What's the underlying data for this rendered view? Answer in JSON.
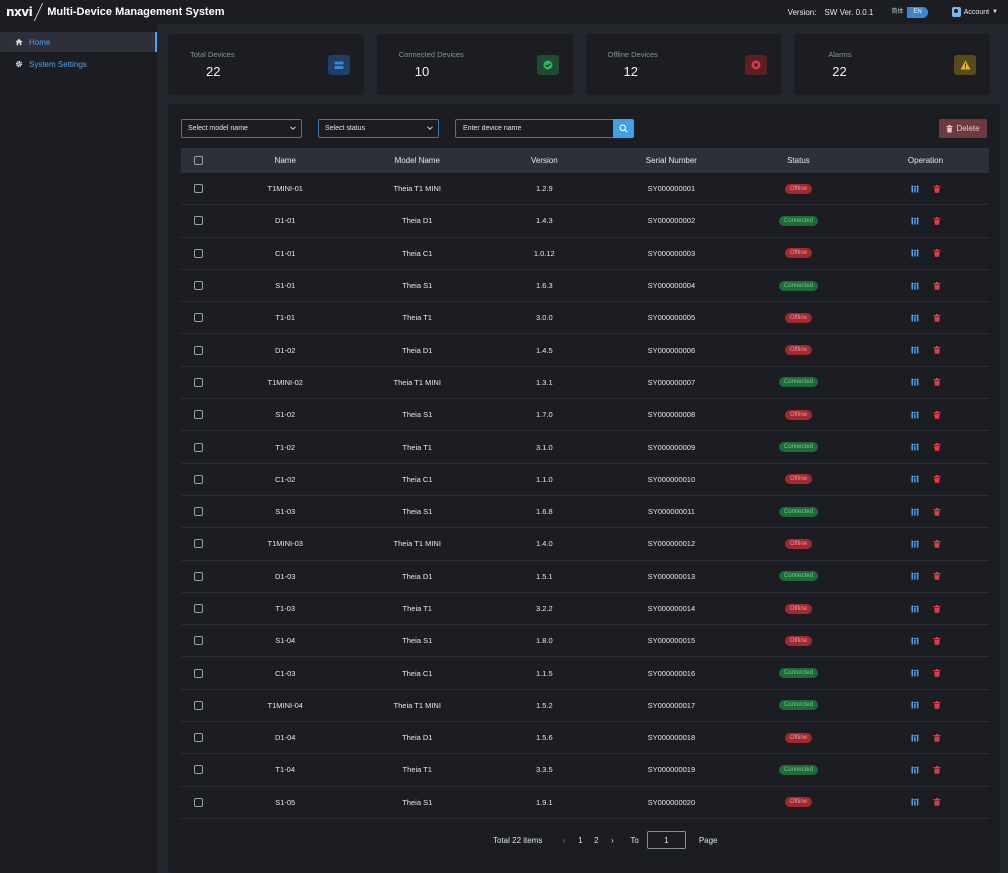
{
  "header": {
    "logo": "nxvi",
    "title": "Multi-Device Management System",
    "version_label": "Version:",
    "version_value": "SW Ver. 0.0.1",
    "lang_inactive": "简体",
    "lang_active": "EN",
    "account_label": "Account"
  },
  "sidebar": {
    "items": [
      {
        "label": "Home",
        "icon": "home-icon",
        "active": true
      },
      {
        "label": "System Settings",
        "icon": "gear-icon",
        "active": false
      }
    ]
  },
  "stats": [
    {
      "label": "Total Devices",
      "value": "22",
      "icon": "stack-icon",
      "color": "#3a86d8"
    },
    {
      "label": "Connected Devices",
      "value": "10",
      "icon": "check-circle-icon",
      "color": "#2fb760"
    },
    {
      "label": "Offline Devices",
      "value": "12",
      "icon": "x-circle-icon",
      "color": "#e03b42"
    },
    {
      "label": "Alarms",
      "value": "22",
      "icon": "warning-icon",
      "color": "#e0b52c"
    }
  ],
  "filters": {
    "model_placeholder": "Select model name",
    "status_placeholder": "Select status",
    "search_placeholder": "Enter device name",
    "delete_label": "Delete"
  },
  "table": {
    "columns": [
      "Name",
      "Model Name",
      "Version",
      "Serial Number",
      "Status",
      "Operation"
    ],
    "rows": [
      {
        "name": "T1MINI-01",
        "model": "Theia T1 MINI",
        "version": "1.2.9",
        "serial": "SY000000001",
        "status": "Offline"
      },
      {
        "name": "D1-01",
        "model": "Theia D1",
        "version": "1.4.3",
        "serial": "SY000000002",
        "status": "Connected"
      },
      {
        "name": "C1-01",
        "model": "Theia C1",
        "version": "1.0.12",
        "serial": "SY000000003",
        "status": "Offline"
      },
      {
        "name": "S1-01",
        "model": "Theia S1",
        "version": "1.6.3",
        "serial": "SY000000004",
        "status": "Connected"
      },
      {
        "name": "T1-01",
        "model": "Theia T1",
        "version": "3.0.0",
        "serial": "SY000000005",
        "status": "Offline"
      },
      {
        "name": "D1-02",
        "model": "Theia D1",
        "version": "1.4.5",
        "serial": "SY000000006",
        "status": "Offline"
      },
      {
        "name": "T1MINI-02",
        "model": "Theia T1 MINI",
        "version": "1.3.1",
        "serial": "SY000000007",
        "status": "Connected"
      },
      {
        "name": "S1-02",
        "model": "Theia S1",
        "version": "1.7.0",
        "serial": "SY000000008",
        "status": "Offline"
      },
      {
        "name": "T1-02",
        "model": "Theia T1",
        "version": "3.1.0",
        "serial": "SY000000009",
        "status": "Connected"
      },
      {
        "name": "C1-02",
        "model": "Theia C1",
        "version": "1.1.0",
        "serial": "SY000000010",
        "status": "Offline"
      },
      {
        "name": "S1-03",
        "model": "Theia S1",
        "version": "1.6.8",
        "serial": "SY000000011",
        "status": "Connected"
      },
      {
        "name": "T1MINI-03",
        "model": "Theia T1 MINI",
        "version": "1.4.0",
        "serial": "SY000000012",
        "status": "Offline"
      },
      {
        "name": "D1-03",
        "model": "Theia D1",
        "version": "1.5.1",
        "serial": "SY000000013",
        "status": "Connected"
      },
      {
        "name": "T1-03",
        "model": "Theia T1",
        "version": "3.2.2",
        "serial": "SY000000014",
        "status": "Offline"
      },
      {
        "name": "S1-04",
        "model": "Theia S1",
        "version": "1.8.0",
        "serial": "SY000000015",
        "status": "Offline"
      },
      {
        "name": "C1-03",
        "model": "Theia C1",
        "version": "1.1.5",
        "serial": "SY000000016",
        "status": "Connected"
      },
      {
        "name": "T1MINI-04",
        "model": "Theia T1 MINI",
        "version": "1.5.2",
        "serial": "SY000000017",
        "status": "Connected"
      },
      {
        "name": "D1-04",
        "model": "Theia D1",
        "version": "1.5.6",
        "serial": "SY000000018",
        "status": "Offline"
      },
      {
        "name": "T1-04",
        "model": "Theia T1",
        "version": "3.3.5",
        "serial": "SY000000019",
        "status": "Connected"
      },
      {
        "name": "S1-05",
        "model": "Theia S1",
        "version": "1.9.1",
        "serial": "SY000000020",
        "status": "Offline"
      }
    ]
  },
  "pagination": {
    "total_label": "Total 22 items",
    "pages": [
      "1",
      "2"
    ],
    "current_page": "1",
    "prev_icon": "chevron-left-icon",
    "next_icon": "chevron-right-icon",
    "to_label": "To",
    "page_input_value": "1",
    "page_label": "Page"
  },
  "colors": {
    "accent": "#4aa3ef",
    "offline": "#a22a2e",
    "connected": "#1f6b38",
    "edit_icon": "#4aa3ef",
    "delete_icon": "#e03b42"
  }
}
